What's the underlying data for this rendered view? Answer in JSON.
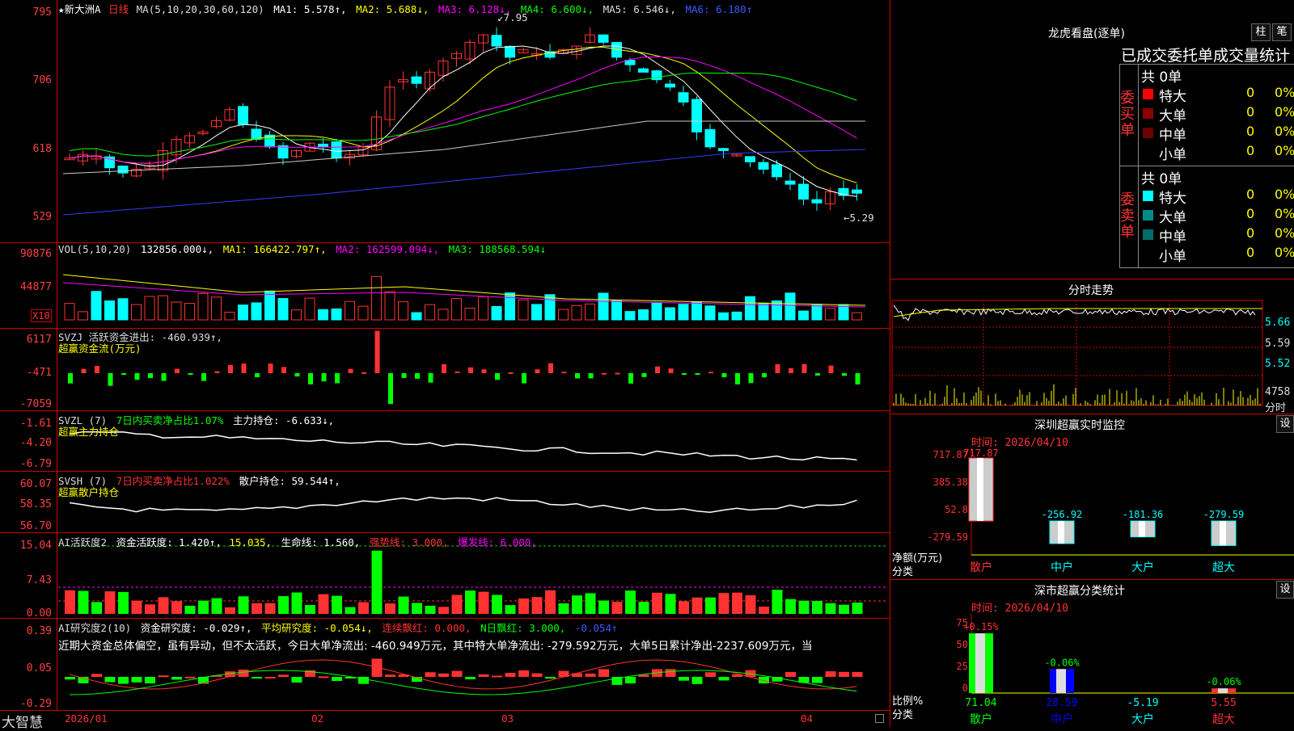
{
  "panels": {
    "price": {
      "title": "★新大洲A",
      "period": "日线",
      "ma_label": "MA(5,10,20,30,60,120)",
      "ma1": "MA1: 5.578↑,",
      "ma2": "MA2: 5.688↓,",
      "ma3": "MA3: 6.128↓,",
      "ma4": "MA4: 6.600↓,",
      "ma5": "MA5: 6.546↓,",
      "ma6": "MA6: 6.180↑",
      "axis": [
        "795",
        "706",
        "618",
        "529"
      ],
      "high_mark": "7.95",
      "low_mark": "5.29"
    },
    "vol": {
      "label": "VOL(5,10,20)",
      "value": "132856.000↓,",
      "ma1": "MA1: 166422.797↑,",
      "ma2": "MA2: 162599.094↓,",
      "ma3": "MA3: 188568.594↓",
      "axis": [
        "90876",
        "44877"
      ],
      "unit": "X10"
    },
    "svzj": {
      "label": "SVZJ  活跃资金进出: -460.939↑,",
      "sub": "超赢资金流(万元)",
      "axis": [
        "6117",
        "-471",
        "-7059"
      ]
    },
    "svzl": {
      "label": "SVZL (7)",
      "ratio": "7日内买卖净占比1.07%",
      "main": "主力持仓: -6.633↓,",
      "sub": "超赢主力持仓",
      "axis": [
        "-1.61",
        "-4.20",
        "-6.79"
      ]
    },
    "svsh": {
      "label": "SVSH (7)",
      "ratio": "7日内买卖净占比1.022%",
      "main": "散户持仓: 59.544↑,",
      "sub": "超赢散户持仓",
      "axis": [
        "60.07",
        "58.35",
        "56.70"
      ]
    },
    "ai1": {
      "label": "AI活跃度2",
      "v1": "资金活跃度: 1.420↑,",
      "v2": "15.035,",
      "v3": "生命线: 1.560,",
      "v4": "强势线: 3.000,",
      "v5": "爆发线: 6.000,",
      "axis": [
        "15.04",
        "7.43",
        "0.00"
      ]
    },
    "ai2": {
      "label": "AI研究度2(10)",
      "v1": "资金研究度: -0.029↑,",
      "v2": "平均研究度: -0.054↓,",
      "v3": "连续飘红: 0.000,",
      "v4": "N日飘红: 3.000,",
      "v5": "-0.054↑",
      "comment": "近期大资金总体偏空，虽有异动，但不太活跃，今日大单净流出: -460.949万元，其中特大单净流出: -279.592万元，大单5日累计净出-2237.609万元，当",
      "axis": [
        "0.39",
        "0.05",
        "-0.29"
      ]
    },
    "xaxis": {
      "brand": "大智慧",
      "dates": [
        "2026/01",
        "02",
        "03",
        "04"
      ]
    }
  },
  "right": {
    "dragon": {
      "title": "龙虎看盘(逐单)",
      "btn1": "柱",
      "btn2": "笔",
      "tabs": "已成交委托单成交量统计",
      "buy_label": "委买单",
      "sell_label": "委卖单",
      "buy_total": "共 0单",
      "sell_total": "共 0单",
      "rows": [
        {
          "name": "特大",
          "count": "0",
          "pct": "0%"
        },
        {
          "name": "大单",
          "count": "0",
          "pct": "0%"
        },
        {
          "name": "中单",
          "count": "0",
          "pct": "0%"
        },
        {
          "name": "小单",
          "count": "0",
          "pct": "0%"
        }
      ],
      "buy_colors": [
        "#ff0000",
        "#8b0000",
        "#6b0000",
        "#000000"
      ],
      "sell_colors": [
        "#00ffff",
        "#008b8b",
        "#006b6b",
        "#000000"
      ]
    },
    "intraday": {
      "title": "分时走势",
      "axis": [
        "5.66",
        "5.59",
        "5.52"
      ],
      "vol_value": "4758",
      "vol_unit": "分时"
    },
    "sz_monitor": {
      "title": "深圳超赢实时监控",
      "set": "设",
      "time": "时间: 2026/04/10",
      "axis": [
        "717.87",
        "385.38",
        "52.8",
        "-279.59"
      ],
      "y_label": "净额(万元)",
      "x_label": "分类",
      "bars": [
        {
          "name": "散户",
          "value": 717.87,
          "label": "717.87"
        },
        {
          "name": "中户",
          "value": -256.92,
          "label": "-256.92"
        },
        {
          "name": "大户",
          "value": -181.36,
          "label": "-181.36"
        },
        {
          "name": "超大",
          "value": -279.59,
          "label": "-279.59"
        }
      ]
    },
    "sz_class": {
      "title": "深市超赢分类统计",
      "set": "设",
      "time": "时间: 2026/04/10",
      "axis": [
        "75",
        "50",
        "25",
        "0"
      ],
      "y_label": "比例%",
      "x_label": "分类",
      "bars": [
        {
          "name": "散户",
          "value": 71.04,
          "delta": "+0.15%",
          "label": "71.04"
        },
        {
          "name": "中户",
          "value": 28.59,
          "delta": "-0.06%",
          "label": "28.59"
        },
        {
          "name": "大户",
          "value": -5.19,
          "delta": "",
          "label": "-5.19"
        },
        {
          "name": "超大",
          "value": 5.55,
          "delta": "-0.06%",
          "label": "5.55"
        }
      ]
    }
  },
  "colors": {
    "up": "#ff3232",
    "down": "#00ffff",
    "grid": "#c00000"
  }
}
